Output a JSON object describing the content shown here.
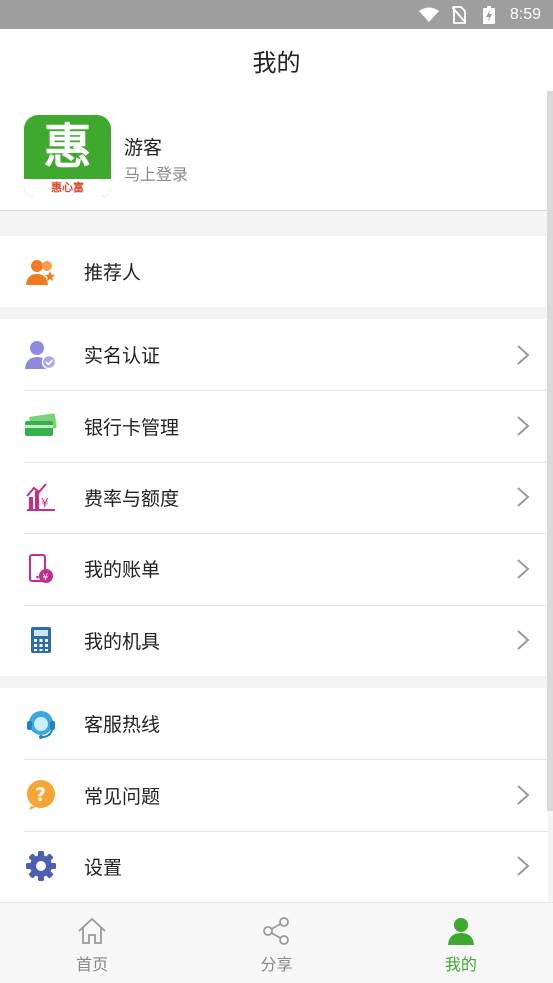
{
  "status_bar": {
    "time": "8:59"
  },
  "header": {
    "title": "我的"
  },
  "profile": {
    "logo_char": "惠",
    "logo_text": "惠心富",
    "user_name": "游客",
    "login_text": "马上登录"
  },
  "menu": {
    "referrer": "推荐人",
    "verify": "实名认证",
    "bank_cards": "银行卡管理",
    "rates": "费率与额度",
    "bills": "我的账单",
    "devices": "我的机具",
    "hotline": "客服热线",
    "faq": "常见问题",
    "settings": "设置"
  },
  "tabs": {
    "home": "首页",
    "share": "分享",
    "mine": "我的"
  },
  "colors": {
    "brand_green": "#3fa92f",
    "orange": "#f07a1e",
    "purple": "#8f8ae0",
    "magenta": "#c42d8a",
    "blue": "#2b6ea8"
  },
  "icons": {
    "referrer": "people-star-icon",
    "verify": "user-check-icon",
    "bank_cards": "bank-card-icon",
    "rates": "chart-yen-icon",
    "bills": "phone-yen-icon",
    "devices": "calculator-icon",
    "hotline": "headset-icon",
    "faq": "question-icon",
    "settings": "gear-icon"
  }
}
